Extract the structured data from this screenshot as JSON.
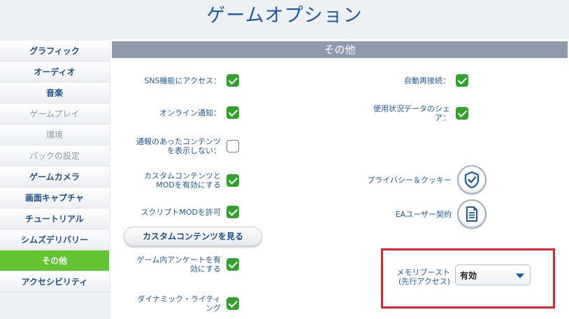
{
  "title": "ゲームオプション",
  "sidebar": {
    "items": [
      {
        "label": "グラフィック",
        "state": "enabled"
      },
      {
        "label": "オーディオ",
        "state": "enabled"
      },
      {
        "label": "音楽",
        "state": "enabled"
      },
      {
        "label": "ゲームプレイ",
        "state": "disabled"
      },
      {
        "label": "環境",
        "state": "disabled"
      },
      {
        "label": "パックの設定",
        "state": "disabled"
      },
      {
        "label": "ゲームカメラ",
        "state": "enabled"
      },
      {
        "label": "画面キャプチャ",
        "state": "enabled"
      },
      {
        "label": "チュートリアル",
        "state": "enabled"
      },
      {
        "label": "シムズデリバリー",
        "state": "enabled"
      },
      {
        "label": "その他",
        "state": "active"
      },
      {
        "label": "アクセシビリティ",
        "state": "enabled"
      }
    ]
  },
  "panel": {
    "header": "その他",
    "left_options": [
      {
        "label": "SNS機能にアクセス：",
        "checked": true
      },
      {
        "label": "オンライン通知：",
        "checked": true
      },
      {
        "label": "通報のあったコンテンツ\nを表示しない：",
        "checked": false
      },
      {
        "label": "カスタムコンテンツと\nMODを有効にする",
        "checked": true
      },
      {
        "label": "スクリプトMODを許可",
        "checked": true
      },
      {
        "label": "ゲーム内アンケートを有\n効にする",
        "checked": true
      },
      {
        "label": "ダイナミック・ライティ\nング",
        "checked": true
      }
    ],
    "right_options": [
      {
        "label": "自動再接続：",
        "checked": true
      },
      {
        "label": "使用状況データのシェ\nア：",
        "checked": true
      }
    ],
    "privacy_label": "プライバシー＆クッキー",
    "privacy_icon": "shield-check-icon",
    "eula_label": "EAユーザー契約",
    "eula_icon": "document-icon",
    "custom_content_button": "カスタムコンテンツを見る",
    "memory_boost": {
      "label": "メモリブースト\n(先行アクセス)",
      "value": "有効"
    }
  },
  "colors": {
    "title_blue": "#1c5aa3",
    "active_green": "#62c430",
    "check_green": "#31a22a",
    "header_gray": "#8e9baa",
    "highlight_red": "#d7262e"
  }
}
